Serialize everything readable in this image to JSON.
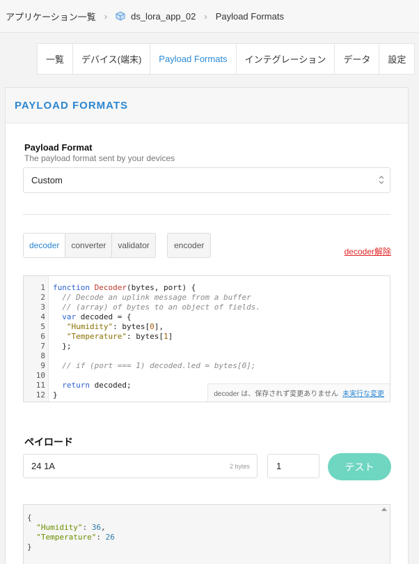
{
  "breadcrumb": {
    "applications": "アプリケーション一覧",
    "app_id": "ds_lora_app_02",
    "current": "Payload Formats"
  },
  "tabs": [
    "一覧",
    "デバイス(端末)",
    "Payload Formats",
    "インテグレーション",
    "データ",
    "設定"
  ],
  "active_tab": "Payload Formats",
  "card": {
    "title": "PAYLOAD FORMATS"
  },
  "format": {
    "label": "Payload Format",
    "description": "The payload format sent by your devices",
    "selected": "Custom"
  },
  "function_tabs": [
    "decoder",
    "converter",
    "validator"
  ],
  "encoder_tab": "encoder",
  "remove_link": "decoder解除",
  "editor": {
    "line_numbers": [
      "1",
      "2",
      "3",
      "4",
      "5",
      "6",
      "7",
      "8",
      "9",
      "10",
      "11",
      "12"
    ],
    "status_text": "decoder は、保存されず変更ありません",
    "status_link": "未実行な変更"
  },
  "payload": {
    "title": "ペイロード",
    "value": "24 1A",
    "bytes": "2 bytes",
    "port": "1",
    "test_button": "テスト"
  },
  "output": {
    "open": "{",
    "humidity_key": "\"Humidity\"",
    "humidity_val": "36",
    "temperature_key": "\"Temperature\"",
    "temperature_val": "26",
    "close": "}"
  },
  "colors": {
    "accent": "#2b86d0",
    "test_button": "#6fd6c1",
    "danger": "#e02424"
  }
}
